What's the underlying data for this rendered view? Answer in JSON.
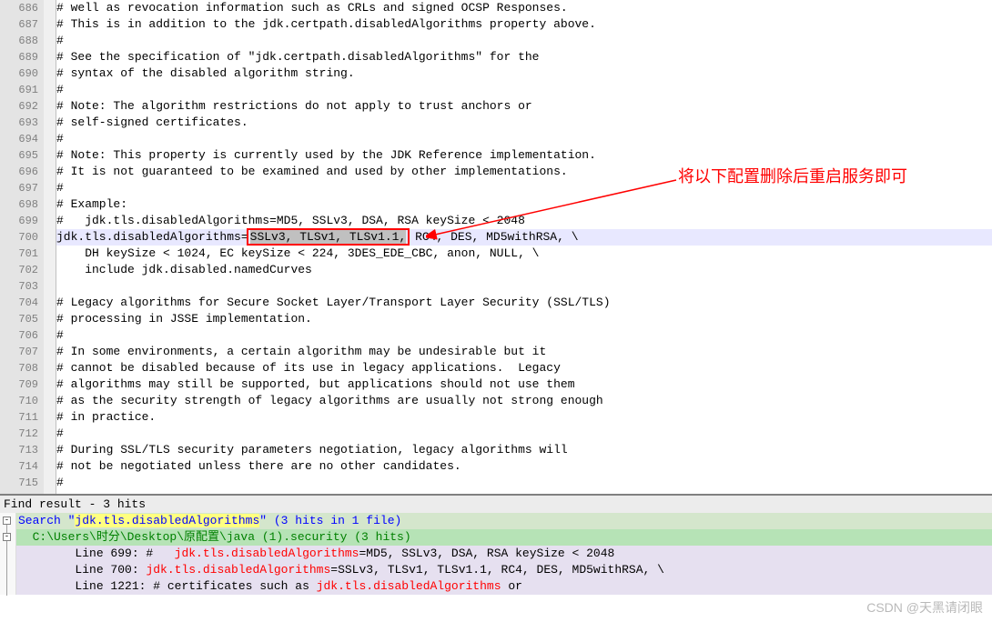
{
  "gutter": [
    "686",
    "687",
    "688",
    "689",
    "690",
    "691",
    "692",
    "693",
    "694",
    "695",
    "696",
    "697",
    "698",
    "699",
    "700",
    "701",
    "702",
    "703",
    "704",
    "705",
    "706",
    "707",
    "708",
    "709",
    "710",
    "711",
    "712",
    "713",
    "714",
    "715"
  ],
  "lines": {
    "l686": "# well as revocation information such as CRLs and signed OCSP Responses.",
    "l687": "# This is in addition to the jdk.certpath.disabledAlgorithms property above.",
    "l688": "#",
    "l689": "# See the specification of \"jdk.certpath.disabledAlgorithms\" for the",
    "l690": "# syntax of the disabled algorithm string.",
    "l691": "#",
    "l692": "# Note: The algorithm restrictions do not apply to trust anchors or",
    "l693": "# self-signed certificates.",
    "l694": "#",
    "l695": "# Note: This property is currently used by the JDK Reference implementation.",
    "l696": "# It is not guaranteed to be examined and used by other implementations.",
    "l697": "#",
    "l698": "# Example:",
    "l699": "#   jdk.tls.disabledAlgorithms=MD5, SSLv3, DSA, RSA keySize < 2048",
    "l700a": "jdk.tls.disabledAlgorithms=",
    "l700sel": "SSLv3, TLSv1, TLSv1.1,",
    "l700b": " RC4, DES, MD5withRSA, \\",
    "l701": "    DH keySize < 1024, EC keySize < 224, 3DES_EDE_CBC, anon, NULL, \\",
    "l702": "    include jdk.disabled.namedCurves",
    "l703": "",
    "l704": "# Legacy algorithms for Secure Socket Layer/Transport Layer Security (SSL/TLS)",
    "l705": "# processing in JSSE implementation.",
    "l706": "#",
    "l707": "# In some environments, a certain algorithm may be undesirable but it",
    "l708": "# cannot be disabled because of its use in legacy applications.  Legacy",
    "l709": "# algorithms may still be supported, but applications should not use them",
    "l710": "# as the security strength of legacy algorithms are usually not strong enough",
    "l711": "# in practice.",
    "l712": "#",
    "l713": "# During SSL/TLS security parameters negotiation, legacy algorithms will",
    "l714": "# not be negotiated unless there are no other candidates.",
    "l715": "#"
  },
  "annotation": "将以下配置删除后重启服务即可",
  "find": {
    "header": "Find result - 3 hits",
    "search_prefix": "Search \"",
    "search_term": "jdk.tls.disabledAlgorithms",
    "search_suffix": "\" (3 hits in 1 file)",
    "file_path": "  C:\\Users\\时分\\Desktop\\原配置\\java (1).security ",
    "file_hits": "(3 hits)",
    "r699a": "\tLine 699: #   ",
    "r699b": "jdk.tls.disabledAlgorithms",
    "r699c": "=MD5, SSLv3, DSA, RSA keySize < 2048",
    "r700a": "\tLine 700: ",
    "r700b": "jdk.tls.disabledAlgorithms",
    "r700c": "=SSLv3, TLSv1, TLSv1.1, RC4, DES, MD5withRSA, \\",
    "r1221a": "\tLine 1221: # certificates such as ",
    "r1221b": "jdk.tls.disabledAlgorithms",
    "r1221c": " or"
  },
  "watermark": "CSDN @天黑请闭眼"
}
